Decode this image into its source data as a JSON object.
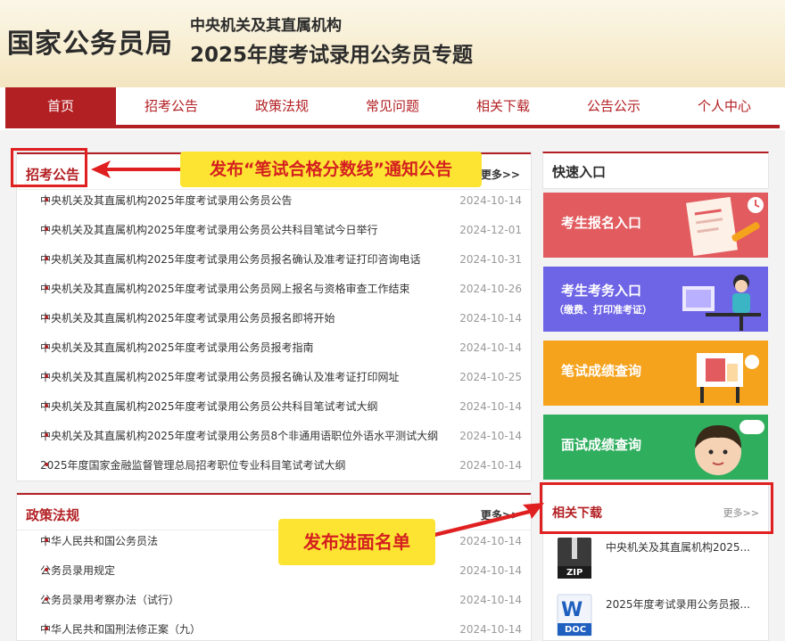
{
  "header": {
    "brand": "国家公务员局",
    "subtitle1": "中央机关及其直属机构",
    "subtitle2": "2025年度考试录用公务员专题"
  },
  "nav": [
    "首页",
    "招考公告",
    "政策法规",
    "常见问题",
    "相关下载",
    "公告公示",
    "个人中心"
  ],
  "announcements": {
    "title": "招考公告",
    "more": "更多>>",
    "items": [
      {
        "title": "中央机关及其直属机构2025年度考试录用公务员公告",
        "date": "2024-10-14"
      },
      {
        "title": "中央机关及其直属机构2025年度考试录用公务员公共科目笔试今日举行",
        "date": "2024-12-01"
      },
      {
        "title": "中央机关及其直属机构2025年度考试录用公务员报名确认及准考证打印咨询电话",
        "date": "2024-10-31"
      },
      {
        "title": "中央机关及其直属机构2025年度考试录用公务员网上报名与资格审查工作结束",
        "date": "2024-10-26"
      },
      {
        "title": "中央机关及其直属机构2025年度考试录用公务员报名即将开始",
        "date": "2024-10-14"
      },
      {
        "title": "中央机关及其直属机构2025年度考试录用公务员报考指南",
        "date": "2024-10-14"
      },
      {
        "title": "中央机关及其直属机构2025年度考试录用公务员报名确认及准考证打印网址",
        "date": "2024-10-25"
      },
      {
        "title": "中央机关及其直属机构2025年度考试录用公务员公共科目笔试考试大纲",
        "date": "2024-10-14"
      },
      {
        "title": "中央机关及其直属机构2025年度考试录用公务员8个非通用语职位外语水平测试大纲",
        "date": "2024-10-14"
      },
      {
        "title": "2025年度国家金融监督管理总局招考职位专业科目笔试考试大纲",
        "date": "2024-10-14"
      }
    ]
  },
  "policy": {
    "title": "政策法规",
    "more": "更多>>",
    "items": [
      {
        "title": "中华人民共和国公务员法",
        "date": "2024-10-14"
      },
      {
        "title": "公务员录用规定",
        "date": "2024-10-14"
      },
      {
        "title": "公务员录用考察办法（试行）",
        "date": "2024-10-14"
      },
      {
        "title": "中华人民共和国刑法修正案（九）",
        "date": "2024-10-14"
      }
    ]
  },
  "quick_entry": {
    "title": "快速入口",
    "tiles": [
      {
        "label": "考生报名入口",
        "color": "#e15b5f",
        "icon": "signup-form-icon"
      },
      {
        "label": "考生考务入口",
        "sub": "（缴费、打印准考证）",
        "color": "#6e64e6",
        "icon": "student-desk-icon"
      },
      {
        "label": "笔试成绩查询",
        "color": "#f5a21c",
        "icon": "score-board-icon"
      },
      {
        "label": "面试成绩查询",
        "color": "#2fae5e",
        "icon": "interview-avatar-icon"
      }
    ]
  },
  "downloads": {
    "title": "相关下载",
    "more": "更多>>",
    "items": [
      {
        "title": "中央机关及其直属机构2025...",
        "type": "ZIP"
      },
      {
        "title": "2025年度考试录用公务员报...",
        "type": "DOC"
      }
    ]
  },
  "annotations": {
    "callout1": "发布“笔试合格分数线”通知公告",
    "callout2": "发布进面名单"
  }
}
